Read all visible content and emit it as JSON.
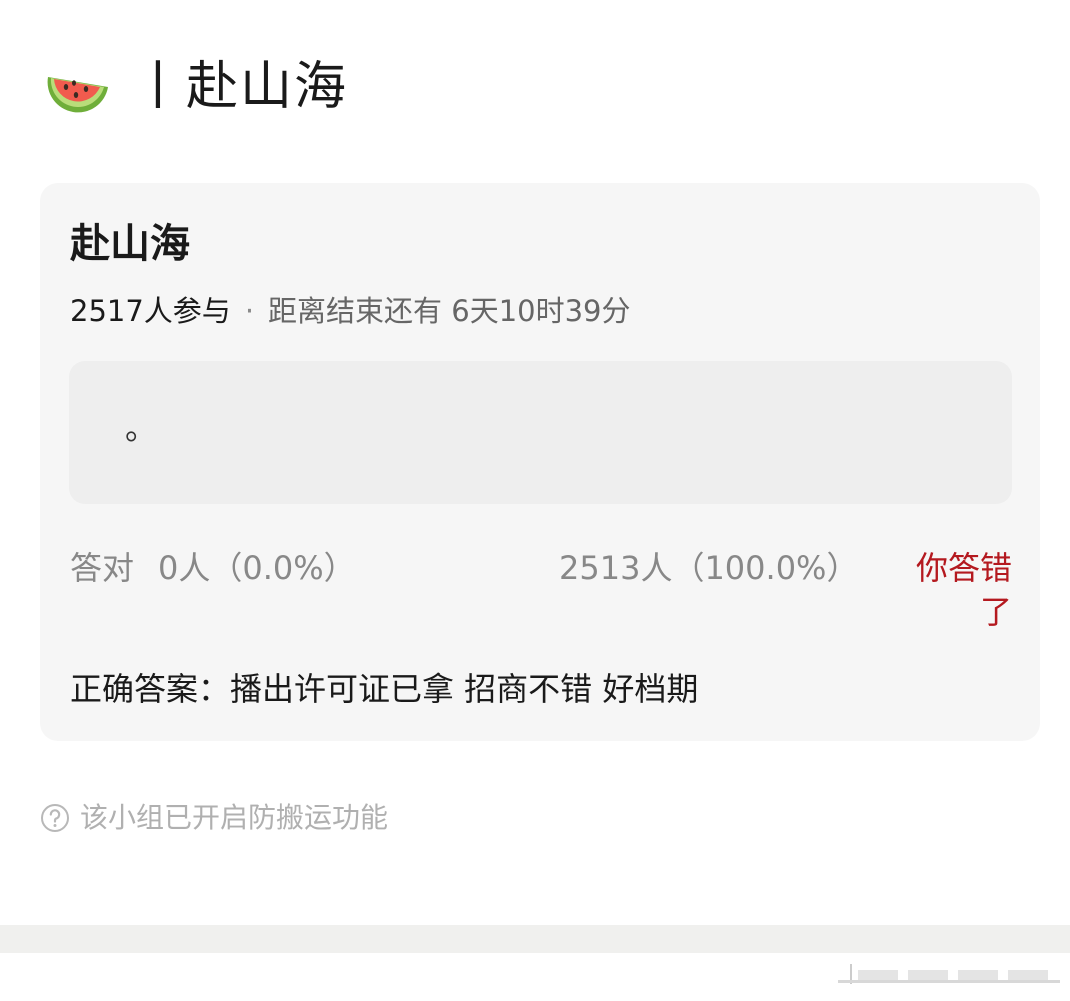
{
  "header": {
    "icon": "watermelon-icon",
    "title": "丨赴山海"
  },
  "card": {
    "title": "赴山海",
    "participants": "2517人参与",
    "separator": "·",
    "remaining": "距离结束还有 6天10时39分",
    "option_text": "。",
    "correct_label": "答对",
    "correct_stats": "0人（0.0%）",
    "other_stats": "2513人（100.0%）",
    "result": "你答错了",
    "answer": "正确答案：播出许可证已拿 招商不错 好档期"
  },
  "note": {
    "icon": "question-circle-icon",
    "text": "该小组已开启防搬运功能"
  },
  "colors": {
    "card_bg": "#f6f6f6",
    "option_bg": "#eeeeee",
    "wrong_red": "#b4191f",
    "muted_gray": "#888888"
  }
}
